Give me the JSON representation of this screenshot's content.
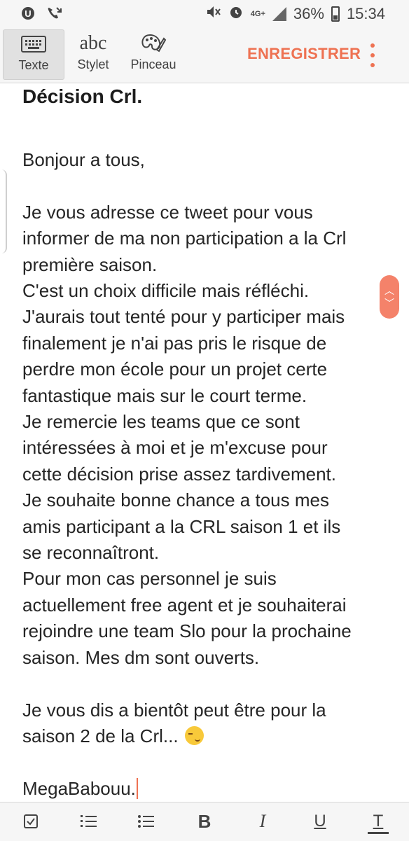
{
  "status_bar": {
    "battery": "36%",
    "time": "15:34",
    "network": "4G+"
  },
  "toolbar": {
    "modes": [
      {
        "label": "Texte",
        "icon": "keyboard-icon",
        "active": true
      },
      {
        "label": "Stylet",
        "icon": "handwriting-abc-icon",
        "active": false
      },
      {
        "label": "Pinceau",
        "icon": "palette-icon",
        "active": false
      }
    ],
    "stylet_icon_text": "abc",
    "save_label": "ENREGISTRER",
    "more_icon": "more-vertical-icon",
    "accent_color": "#ee7252"
  },
  "note": {
    "title": "Décision Crl.",
    "lines": [
      "Bonjour a tous,",
      "",
      "Je vous adresse ce tweet pour vous",
      "informer de ma non participation a la Crl",
      "première saison.",
      "C'est un choix difficile mais réfléchi.",
      "J'aurais tout tenté pour y participer mais",
      "finalement je n'ai pas pris le risque de",
      "perdre mon école pour un projet certe",
      "fantastique mais sur le court terme.",
      "Je remercie les teams que ce sont",
      "intéressées à moi et je m'excuse pour",
      "cette décision prise assez tardivement.",
      "Je souhaite bonne chance a tous mes",
      "amis participant a la CRL saison 1 et ils",
      "se reconnaîtront.",
      "Pour mon cas personnel je suis",
      "actuellement free agent et je souhaiterai",
      "rejoindre une team Slo pour la prochaine",
      "saison. Mes dm sont ouverts.",
      "",
      "Je vous dis a bientôt peut être pour la",
      "saison 2 de la Crl... ",
      "",
      "MegaBabouu."
    ],
    "emoji_icon": "smirking-face-icon"
  },
  "format_bar": {
    "items": [
      "checkbox-icon",
      "numbered-list-icon",
      "bulleted-list-icon",
      "bold-icon",
      "italic-icon",
      "underline-icon",
      "text-format-icon"
    ],
    "bold_glyph": "B",
    "italic_glyph": "I",
    "underline_glyph": "U",
    "text_glyph": "T"
  }
}
